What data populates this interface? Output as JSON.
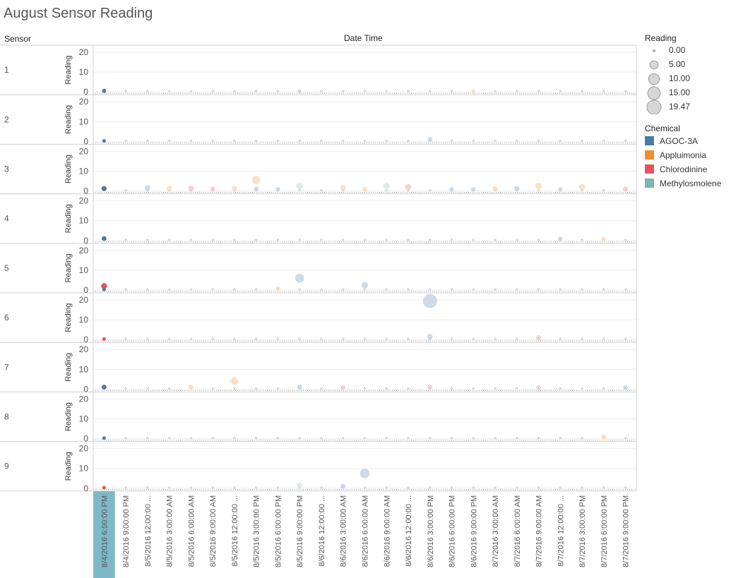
{
  "title": "August Sensor Reading",
  "headers": {
    "row_dim": "Sensor",
    "col_dim": "Date Time"
  },
  "legend_size": {
    "title": "Reading",
    "items": [
      "0.00",
      "5.00",
      "10.00",
      "15.00",
      "19.47"
    ]
  },
  "legend_color": {
    "title": "Chemical",
    "items": [
      {
        "label": "AGOC-3A",
        "color": "#4e79a7"
      },
      {
        "label": "Appluimonia",
        "color": "#f28e2b"
      },
      {
        "label": "Chlorodinine",
        "color": "#e15759"
      },
      {
        "label": "Methylosmolene",
        "color": "#76b7b2"
      }
    ]
  },
  "chart_data": {
    "type": "scatter",
    "title": "August Sensor Reading",
    "xlabel": "Date Time",
    "ylabel": "Reading",
    "rows": [
      "1",
      "2",
      "3",
      "4",
      "5",
      "6",
      "7",
      "8",
      "9"
    ],
    "ylim": [
      0,
      20
    ],
    "yticks": [
      0,
      10,
      20
    ],
    "x_categories": [
      "8/4/2016 6:00:00 PM",
      "8/4/2016 9:00:00 PM",
      "8/5/2016 12:00:00 ...",
      "8/5/2016 3:00:00 AM",
      "8/5/2016 6:00:00 AM",
      "8/5/2016 9:00:00 AM",
      "8/5/2016 12:00:00 ...",
      "8/5/2016 3:00:00 PM",
      "8/5/2016 6:00:00 PM",
      "8/5/2016 9:00:00 PM",
      "8/6/2016 12:00:00 ...",
      "8/6/2016 3:00:00 AM",
      "8/6/2016 6:00:00 AM",
      "8/6/2016 9:00:00 AM",
      "8/6/2016 12:00:00 ...",
      "8/6/2016 3:00:00 PM",
      "8/6/2016 6:00:00 PM",
      "8/6/2016 9:00:00 PM",
      "8/7/2016 3:00:00 AM",
      "8/7/2016 6:00:00 AM",
      "8/7/2016 9:00:00 AM",
      "8/7/2016 12:00:00 ...",
      "8/7/2016 3:00:00 PM",
      "8/7/2016 6:00:00 PM",
      "8/7/2016 9:00:00 PM"
    ],
    "highlighted_category": "8/4/2016 6:00:00 PM",
    "size_legend_values": [
      0,
      5,
      10,
      15,
      19.47
    ],
    "series": [
      "AGOC-3A",
      "Appluimonia",
      "Chlorodinine",
      "Methylosmolene"
    ],
    "points": [
      {
        "row": "1",
        "x": 0,
        "chem": "AGOC-3A",
        "v": 0.5,
        "hl": true
      },
      {
        "row": "1",
        "x": 9,
        "chem": "AGOC-3A",
        "v": 0.3
      },
      {
        "row": "1",
        "x": 17,
        "chem": "Appluimonia",
        "v": 0.3
      },
      {
        "row": "2",
        "x": 0,
        "chem": "AGOC-3A",
        "v": 0.3,
        "hl": true
      },
      {
        "row": "2",
        "x": 15,
        "chem": "AGOC-3A",
        "v": 1.0
      },
      {
        "row": "3",
        "x": 0,
        "chem": "AGOC-3A",
        "v": 1.2,
        "hl": true
      },
      {
        "row": "3",
        "x": 2,
        "chem": "AGOC-3A",
        "v": 1.5
      },
      {
        "row": "3",
        "x": 3,
        "chem": "Appluimonia",
        "v": 1.3
      },
      {
        "row": "3",
        "x": 4,
        "chem": "Chlorodinine",
        "v": 1.3
      },
      {
        "row": "3",
        "x": 5,
        "chem": "Chlorodinine",
        "v": 1.0
      },
      {
        "row": "3",
        "x": 6,
        "chem": "Appluimonia",
        "v": 1.3
      },
      {
        "row": "3",
        "x": 7,
        "chem": "Appluimonia",
        "v": 5.5
      },
      {
        "row": "3",
        "x": 7,
        "chem": "AGOC-3A",
        "v": 1.0
      },
      {
        "row": "3",
        "x": 8,
        "chem": "AGOC-3A",
        "v": 0.8
      },
      {
        "row": "3",
        "x": 9,
        "chem": "Methylosmolene",
        "v": 2.5
      },
      {
        "row": "3",
        "x": 11,
        "chem": "Appluimonia",
        "v": 1.5
      },
      {
        "row": "3",
        "x": 12,
        "chem": "Appluimonia",
        "v": 1.0
      },
      {
        "row": "3",
        "x": 13,
        "chem": "Methylosmolene",
        "v": 2.5
      },
      {
        "row": "3",
        "x": 14,
        "chem": "Chlorodinine",
        "v": 2.0
      },
      {
        "row": "3",
        "x": 16,
        "chem": "AGOC-3A",
        "v": 0.8
      },
      {
        "row": "3",
        "x": 17,
        "chem": "AGOC-3A",
        "v": 0.8
      },
      {
        "row": "3",
        "x": 18,
        "chem": "Appluimonia",
        "v": 1.2
      },
      {
        "row": "3",
        "x": 19,
        "chem": "AGOC-3A",
        "v": 1.2
      },
      {
        "row": "3",
        "x": 20,
        "chem": "Appluimonia",
        "v": 2.5
      },
      {
        "row": "3",
        "x": 21,
        "chem": "AGOC-3A",
        "v": 0.8
      },
      {
        "row": "3",
        "x": 22,
        "chem": "Appluimonia",
        "v": 2.0
      },
      {
        "row": "3",
        "x": 24,
        "chem": "Chlorodinine",
        "v": 1.0
      },
      {
        "row": "4",
        "x": 0,
        "chem": "AGOC-3A",
        "v": 1.0,
        "hl": true
      },
      {
        "row": "4",
        "x": 21,
        "chem": "AGOC-3A",
        "v": 0.8
      },
      {
        "row": "4",
        "x": 23,
        "chem": "Appluimonia",
        "v": 0.8
      },
      {
        "row": "5",
        "x": 0,
        "chem": "Chlorodinine",
        "v": 2.0,
        "hl": true
      },
      {
        "row": "5",
        "x": 0,
        "chem": "AGOC-3A",
        "v": 0.3,
        "hl": true
      },
      {
        "row": "5",
        "x": 8,
        "chem": "Appluimonia",
        "v": 0.8
      },
      {
        "row": "5",
        "x": 9,
        "chem": "AGOC-3A",
        "v": 6.0
      },
      {
        "row": "5",
        "x": 12,
        "chem": "AGOC-3A",
        "v": 2.5
      },
      {
        "row": "6",
        "x": 0,
        "chem": "Chlorodinine",
        "v": 0.3,
        "hl": true
      },
      {
        "row": "6",
        "x": 15,
        "chem": "AGOC-3A",
        "v": 19.47
      },
      {
        "row": "6",
        "x": 15,
        "chem": "AGOC-3A",
        "v": 1.5
      },
      {
        "row": "6",
        "x": 20,
        "chem": "Chlorodinine",
        "v": 1.0
      },
      {
        "row": "7",
        "x": 0,
        "chem": "AGOC-3A",
        "v": 1.0,
        "hl": true
      },
      {
        "row": "7",
        "x": 4,
        "chem": "Appluimonia",
        "v": 1.0
      },
      {
        "row": "7",
        "x": 6,
        "chem": "Appluimonia",
        "v": 4.0
      },
      {
        "row": "7",
        "x": 9,
        "chem": "AGOC-3A",
        "v": 1.0
      },
      {
        "row": "7",
        "x": 11,
        "chem": "Chlorodinine",
        "v": 0.8
      },
      {
        "row": "7",
        "x": 15,
        "chem": "Chlorodinine",
        "v": 1.0
      },
      {
        "row": "7",
        "x": 20,
        "chem": "Chlorodinine",
        "v": 0.8
      },
      {
        "row": "7",
        "x": 24,
        "chem": "AGOC-3A",
        "v": 0.8
      },
      {
        "row": "8",
        "x": 0,
        "chem": "AGOC-3A",
        "v": 0.3,
        "hl": true
      },
      {
        "row": "8",
        "x": 23,
        "chem": "Appluimonia",
        "v": 1.0
      },
      {
        "row": "9",
        "x": 0,
        "chem": "Chlorodinine",
        "v": 0.3,
        "hl": true
      },
      {
        "row": "9",
        "x": 9,
        "chem": "Methylosmolene",
        "v": 1.5
      },
      {
        "row": "9",
        "x": 11,
        "chem": "AGOC-3A",
        "v": 1.0
      },
      {
        "row": "9",
        "x": 12,
        "chem": "AGOC-3A",
        "v": 7.5
      }
    ]
  }
}
